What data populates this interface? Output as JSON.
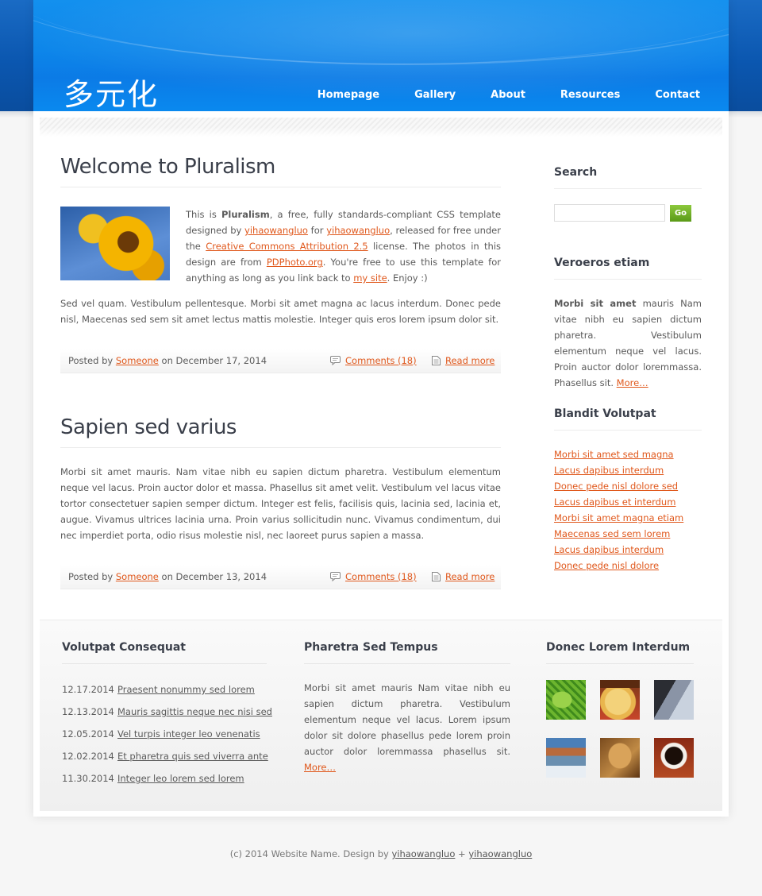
{
  "header": {
    "logo": "多元化",
    "nav": [
      "Homepage",
      "Gallery",
      "About",
      "Resources",
      "Contact"
    ]
  },
  "posts": [
    {
      "title": "Welcome to Pluralism",
      "intro": {
        "t1": "This is ",
        "bold": "Pluralism",
        "t2": ", a free, fully standards-compliant CSS template designed by ",
        "link1": "yihaowangluo",
        "t3": " for ",
        "link2": "yihaowangluo",
        "t4": ", released for free under the ",
        "link3": "Creative Commons Attribution 2.5",
        "t5": " license. The photos in this design are from ",
        "link4": "PDPhoto.org",
        "t6": ". You're free to use this template for anything as long as you link back to ",
        "link5": "my site",
        "t7": ". Enjoy :)"
      },
      "body": "Sed vel quam. Vestibulum pellentesque. Morbi sit amet magna ac lacus interdum. Donec pede nisl, Maecenas sed sem sit amet lectus mattis molestie. Integer quis eros lorem ipsum dolor sit.",
      "meta": {
        "posted_by": "Posted by",
        "author": "Someone",
        "on": "on December 17, 2014",
        "comments": "Comments (18)",
        "read_more": "Read more"
      }
    },
    {
      "title": "Sapien sed varius",
      "body": "Morbi sit amet mauris. Nam vitae nibh eu sapien dictum pharetra. Vestibulum elementum neque vel lacus. Proin auctor dolor et massa. Phasellus sit amet velit. Vestibulum vel lacus vitae tortor consectetuer sapien semper dictum. Integer est felis, facilisis quis, lacinia sed, lacinia et, augue. Vivamus ultrices lacinia urna. Proin varius sollicitudin nunc. Vivamus condimentum, dui nec imperdiet porta, odio risus molestie nisl, nec laoreet purus sapien a massa.",
      "meta": {
        "posted_by": "Posted by",
        "author": "Someone",
        "on": "on December 13, 2014",
        "comments": "Comments (18)",
        "read_more": "Read more"
      }
    }
  ],
  "sidebar": {
    "search": {
      "title": "Search",
      "button": "Go",
      "value": ""
    },
    "veroeros": {
      "title": "Veroeros etiam",
      "bold": "Morbi sit amet",
      "text": " mauris Nam vitae nibh eu sapien dictum pharetra. Vestibulum elementum neque vel lacus. Proin auctor dolor loremmassa. Phasellus sit. ",
      "more": "More…"
    },
    "blandit": {
      "title": "Blandit Volutpat",
      "links": [
        "Morbi sit amet sed magna",
        "Lacus dapibus interdum",
        "Donec pede nisl dolore sed",
        "Lacus dapibus et interdum",
        "Morbi sit amet magna etiam",
        "Maecenas sed sem lorem",
        "Lacus dapibus interdum",
        "Donec pede nisl dolore"
      ]
    }
  },
  "footer": {
    "col1": {
      "title": "Volutpat Consequat",
      "items": [
        {
          "date": "12.17.2014",
          "text": "Praesent nonummy sed lorem"
        },
        {
          "date": "12.13.2014",
          "text": "Mauris sagittis neque nec nisi sed"
        },
        {
          "date": "12.05.2014",
          "text": "Vel turpis integer leo venenatis"
        },
        {
          "date": "12.02.2014",
          "text": "Et pharetra quis sed viverra ante"
        },
        {
          "date": "11.30.2014",
          "text": "Integer leo lorem sed lorem"
        }
      ]
    },
    "col2": {
      "title": "Pharetra Sed Tempus",
      "text": "Morbi sit amet mauris Nam vitae nibh eu sapien dictum pharetra. Vestibulum elementum neque vel lacus. Lorem ipsum dolor sit dolore phasellus pede lorem proin auctor dolor loremmassa phasellus sit. ",
      "more": "More…"
    },
    "col3": {
      "title": "Donec Lorem Interdum",
      "thumbs": [
        "leaf-photo",
        "cheese-photo",
        "cliff-photo",
        "coast-photo",
        "cat-photo",
        "coffee-photo"
      ]
    }
  },
  "copyright": {
    "text": "(c) 2014 Website Name. Design by ",
    "link1": "yihaowangluo",
    "plus": " + ",
    "link2": "yihaowangluo"
  }
}
